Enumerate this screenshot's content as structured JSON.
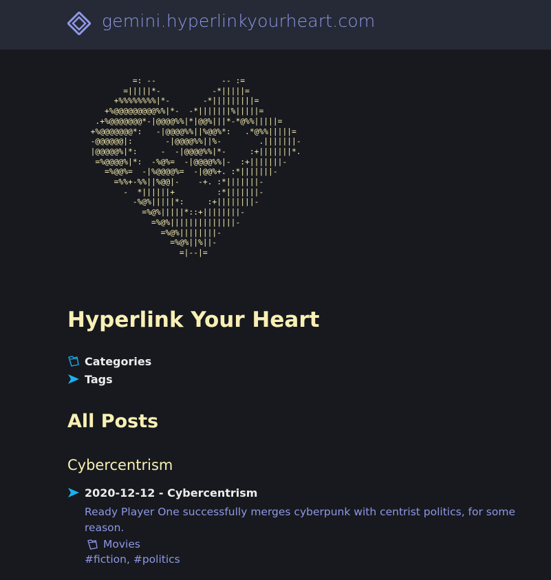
{
  "header": {
    "site_host": "gemini.hyperlinkyourheart.com",
    "logo_icon": "diamond-logo-icon"
  },
  "hero": {
    "ascii_art": "           =: --              -- :=\n         =|||||*-           -*|||||=\n       +%%%%%%%%|*-       -*|||||||||=\n     +%@@@@@@@@@%%|*-  -*|||||||%|||||=\n   .+%@@@@@@@*-|@@@@%%|*|@@%|||*-*@%%|||||=\n  +%@@@@@@@*:   -|@@@@%%||%@@%*:   .*@%%|||||=\n  -@@@@@@|:       -|@@@@%%||%-        .|||||||-\n  |@@@@@%|*:     -  -|@@@@%%|*-     :+|||||||*.\n   =%@@@@%|*:  -%@%=  -|@@@@%%|-  :+|||||||-\n     =%@@%=  -|%@@@@%=  -|@@%+. :*|||||||-\n       =%%+-%%||%@@|-    -+. :*|||||||-\n         -  *||||||+         :*|||||||-\n           -%@%|||||*:     :+||||||||-\n             =%@%|||||*::+||||||||-\n               =%@%||||||||||||||-\n                 =%@%||||||||-\n                   =%@%||%||-\n                     =|--|=",
    "title": "Hyperlink Your Heart"
  },
  "nav": {
    "items": [
      {
        "label": "Categories",
        "icon": "folder-icon"
      },
      {
        "label": "Tags",
        "icon": "arrow-right-icon"
      }
    ]
  },
  "posts_section": {
    "heading": "All Posts",
    "category_heading": "Cybercentrism",
    "post": {
      "title": "2020-12-12 - Cybercentrism",
      "summary": "Ready Player One successfully merges cyberpunk with centrist politics, for some reason.",
      "category": "Movies",
      "tags": [
        "#fiction",
        "#politics"
      ],
      "tags_separator": ", "
    }
  },
  "colors": {
    "background": "#17191e",
    "header_bg": "#262a36",
    "accent_link": "#8f98e6",
    "heading_yellow": "#f8f0b4",
    "arrow_blue": "#1ab0f0"
  }
}
